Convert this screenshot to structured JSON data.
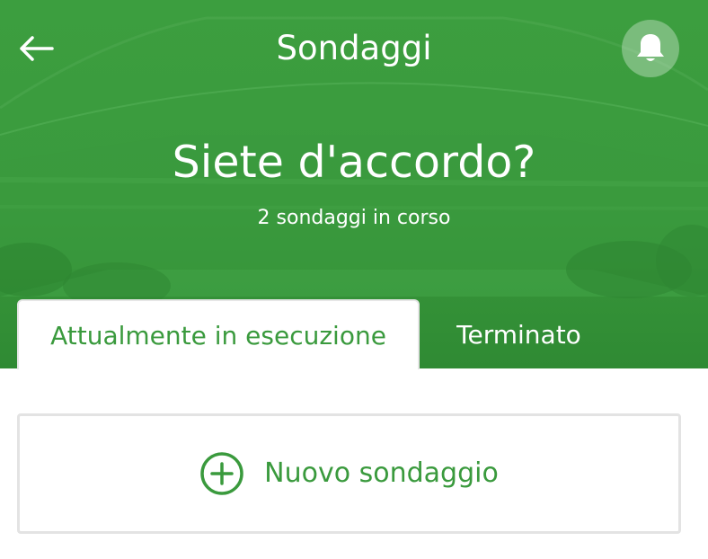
{
  "header": {
    "back_icon": "arrow-left-icon",
    "title": "Sondaggi",
    "bell_icon": "bell-icon"
  },
  "hero": {
    "headline": "Siete d'accordo?",
    "subline": "2 sondaggi in corso"
  },
  "tabs": [
    {
      "label": "Attualmente in esecuzione",
      "active": true
    },
    {
      "label": "Terminato",
      "active": false
    }
  ],
  "new_poll": {
    "icon": "plus-circle-icon",
    "label": "Nuovo sondaggio"
  },
  "colors": {
    "accent": "#3a9a3d",
    "white": "#ffffff",
    "card_border": "#e3e3e3"
  }
}
